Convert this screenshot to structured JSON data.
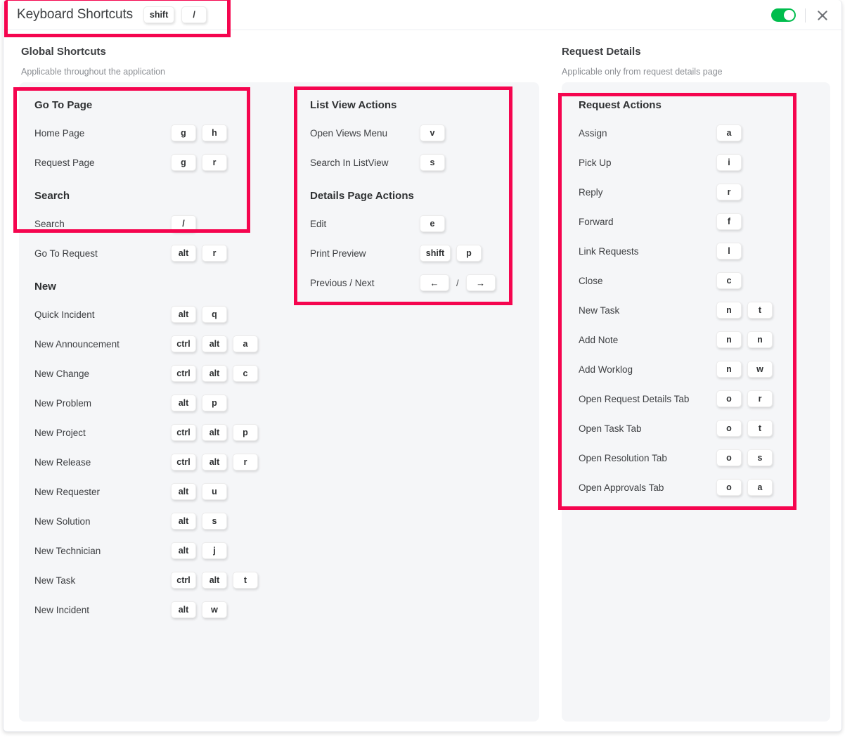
{
  "header": {
    "title": "Keyboard Shortcuts",
    "keys": [
      "shift",
      "/"
    ],
    "toggle_name": "shortcuts-enabled-toggle",
    "toggle_state": "on",
    "toggle_color": "#00bd4d",
    "close_label": "×"
  },
  "annotation_color": "#f5054f",
  "sections": [
    {
      "title": "Global Shortcuts",
      "subtitle": "Applicable throughout the application",
      "groups_left": [
        {
          "title": "Go To Page",
          "rows": [
            {
              "label": "Home Page",
              "keys": [
                "g",
                "h"
              ]
            },
            {
              "label": "Request Page",
              "keys": [
                "g",
                "r"
              ]
            }
          ]
        },
        {
          "title": "Search",
          "rows": [
            {
              "label": "Search",
              "keys": [
                "/"
              ]
            },
            {
              "label": "Go To Request",
              "keys": [
                "alt",
                "r"
              ]
            }
          ]
        },
        {
          "title": "New",
          "rows": [
            {
              "label": "Quick Incident",
              "keys": [
                "alt",
                "q"
              ]
            },
            {
              "label": "New Announcement",
              "keys": [
                "ctrl",
                "alt",
                "a"
              ]
            },
            {
              "label": "New Change",
              "keys": [
                "ctrl",
                "alt",
                "c"
              ]
            },
            {
              "label": "New Problem",
              "keys": [
                "alt",
                "p"
              ]
            },
            {
              "label": "New Project",
              "keys": [
                "ctrl",
                "alt",
                "p"
              ]
            },
            {
              "label": "New Release",
              "keys": [
                "ctrl",
                "alt",
                "r"
              ]
            },
            {
              "label": "New Requester",
              "keys": [
                "alt",
                "u"
              ]
            },
            {
              "label": "New Solution",
              "keys": [
                "alt",
                "s"
              ]
            },
            {
              "label": "New Technician",
              "keys": [
                "alt",
                "j"
              ]
            },
            {
              "label": "New Task",
              "keys": [
                "ctrl",
                "alt",
                "t"
              ]
            },
            {
              "label": "New Incident",
              "keys": [
                "alt",
                "w"
              ]
            }
          ]
        }
      ],
      "groups_middle": [
        {
          "title": "List View Actions",
          "rows": [
            {
              "label": "Open Views Menu",
              "keys": [
                "v"
              ]
            },
            {
              "label": "Search In ListView",
              "keys": [
                "s"
              ]
            }
          ]
        },
        {
          "title": "Details Page Actions",
          "rows": [
            {
              "label": "Edit",
              "keys": [
                "e"
              ]
            },
            {
              "label": "Print Preview",
              "keys": [
                "shift",
                "p"
              ]
            },
            {
              "label": "Previous / Next",
              "keys": [
                "←",
                "/",
                "→"
              ]
            }
          ]
        }
      ]
    },
    {
      "title": "Request Details",
      "subtitle": "Applicable only from request details page",
      "groups_right": [
        {
          "title": "Request Actions",
          "rows": [
            {
              "label": "Assign",
              "keys": [
                "a"
              ]
            },
            {
              "label": "Pick Up",
              "keys": [
                "i"
              ]
            },
            {
              "label": "Reply",
              "keys": [
                "r"
              ]
            },
            {
              "label": "Forward",
              "keys": [
                "f"
              ]
            },
            {
              "label": "Link Requests",
              "keys": [
                "l"
              ]
            },
            {
              "label": "Close",
              "keys": [
                "c"
              ]
            },
            {
              "label": "New Task",
              "keys": [
                "n",
                "t"
              ]
            },
            {
              "label": "Add Note",
              "keys": [
                "n",
                "n"
              ]
            },
            {
              "label": "Add Worklog",
              "keys": [
                "n",
                "w"
              ]
            },
            {
              "label": "Open Request Details Tab",
              "keys": [
                "o",
                "r"
              ]
            },
            {
              "label": "Open Task Tab",
              "keys": [
                "o",
                "t"
              ]
            },
            {
              "label": "Open Resolution Tab",
              "keys": [
                "o",
                "s"
              ]
            },
            {
              "label": "Open Approvals Tab",
              "keys": [
                "o",
                "a"
              ]
            }
          ]
        }
      ]
    }
  ]
}
